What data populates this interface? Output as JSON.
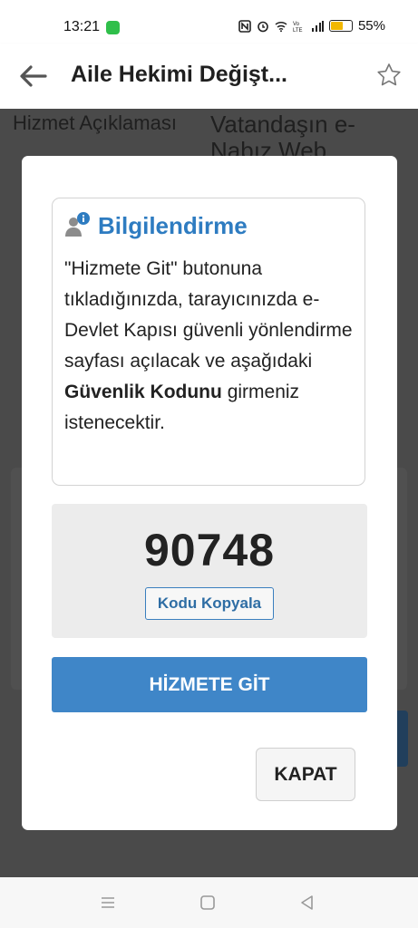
{
  "status_bar": {
    "time": "13:21",
    "battery_percent": "55%",
    "icons": [
      "message-icon",
      "nfc-icon",
      "alarm-icon",
      "wifi-icon",
      "volte-icon",
      "signal-icon",
      "battery-icon"
    ]
  },
  "app_bar": {
    "title": "Aile Hekimi Değişt...",
    "back_icon": "arrow-left-icon",
    "favorite_icon": "star-outline-icon"
  },
  "background": {
    "label": "Hizmet Açıklaması",
    "value": "Vatandaşın e-Nabız Web"
  },
  "dialog": {
    "info": {
      "icon": "user-info-icon",
      "title": "Bilgilendirme",
      "text_before": "\"Hizmete Git\" butonuna tıkladığınızda, tarayıcınızda e-Devlet Kapısı güvenli yönlendirme sayfası açılacak ve aşağıdaki",
      "text_bold": "Güvenlik Kodunu",
      "text_after": "girmeniz istenecektir."
    },
    "code": "90748",
    "copy_label": "Kodu Kopyala",
    "go_label": "HİZMETE GİT",
    "close_label": "KAPAT"
  },
  "nav_bar": {
    "items": [
      "menu-icon",
      "home-icon",
      "back-triangle-icon"
    ]
  },
  "colors": {
    "accent": "#3f86c8",
    "title_blue": "#2e7cc1",
    "overlay": "#4a4a4a"
  }
}
